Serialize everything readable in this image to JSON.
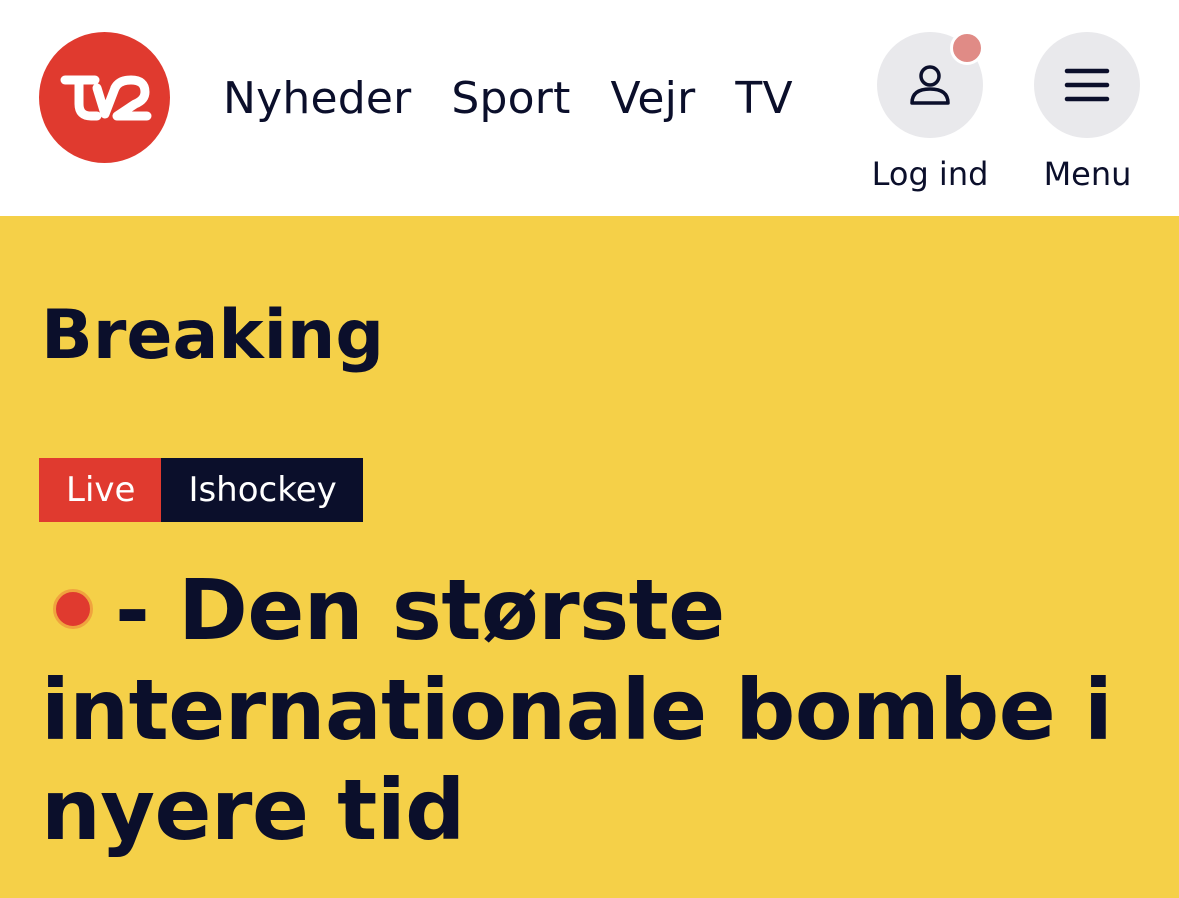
{
  "brand": {
    "logo_text": "TV2",
    "logo_color": "#e03a2f"
  },
  "nav": {
    "items": [
      {
        "label": "Nyheder"
      },
      {
        "label": "Sport"
      },
      {
        "label": "Vejr"
      },
      {
        "label": "TV"
      }
    ]
  },
  "header_actions": {
    "login": {
      "label": "Log ind",
      "icon": "user-icon",
      "has_notification": true
    },
    "menu": {
      "label": "Menu",
      "icon": "hamburger-icon"
    }
  },
  "breaking": {
    "section_title": "Breaking",
    "background": "#f5d048",
    "tags": {
      "live": "Live",
      "category": "Ishockey"
    },
    "headline": "- Den største internationale bombe i nyere tid",
    "live_indicator": "red-dot-icon"
  },
  "colors": {
    "accent_red": "#e03a2f",
    "dark_navy": "#0b0f2b",
    "breaking_yellow": "#f5d048",
    "icon_button_bg": "#e9e9ec",
    "notification_dot": "#e08b86"
  }
}
